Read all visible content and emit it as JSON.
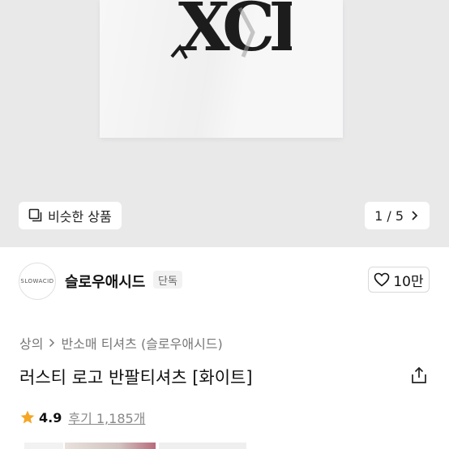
{
  "hero": {
    "similar_label": "비슷한 상품",
    "pager": "1 / 5",
    "print_text": "XCD"
  },
  "store": {
    "logo_text": "SLOWACID",
    "name": "슬로우애시드",
    "badge": "단독",
    "likes": "10만"
  },
  "breadcrumb": {
    "root": "상의",
    "category": "반소매 티셔츠 (슬로우애시드)"
  },
  "product": {
    "title": "러스티 로고 반팔티셔츠 [화이트]"
  },
  "rating": {
    "score": "4.9",
    "reviews": "후기 1,185개"
  },
  "colors": {
    "star": "#F5A623",
    "hero_bg": "#E9E9EA"
  }
}
